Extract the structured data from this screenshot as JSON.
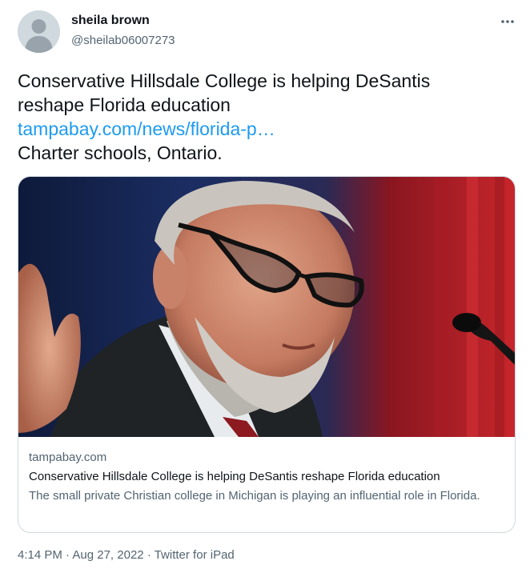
{
  "tweet": {
    "author": {
      "name": "sheila brown",
      "handle": "@sheilab06007273"
    },
    "text": {
      "line1": "Conservative Hillsdale College is helping DeSantis",
      "line2": "reshape Florida education",
      "link": "tampabay.com/news/florida-p…",
      "line4": "Charter schools, Ontario."
    },
    "card": {
      "domain": "tampabay.com",
      "title": "Conservative Hillsdale College is helping DeSantis reshape Florida education",
      "description": "The small private Christian college in Michigan is playing an influential role in Florida."
    },
    "footer": {
      "time": "4:14 PM",
      "separator1": "·",
      "date": "Aug 27, 2022",
      "separator2": "·",
      "source": "Twitter for iPad"
    }
  },
  "colors": {
    "link": "#1d9bf0",
    "secondary_text": "#536471",
    "primary_text": "#0f1419",
    "border": "#cfd9de"
  },
  "icons": {
    "avatar": "default-profile-icon",
    "more": "more-options-icon"
  }
}
